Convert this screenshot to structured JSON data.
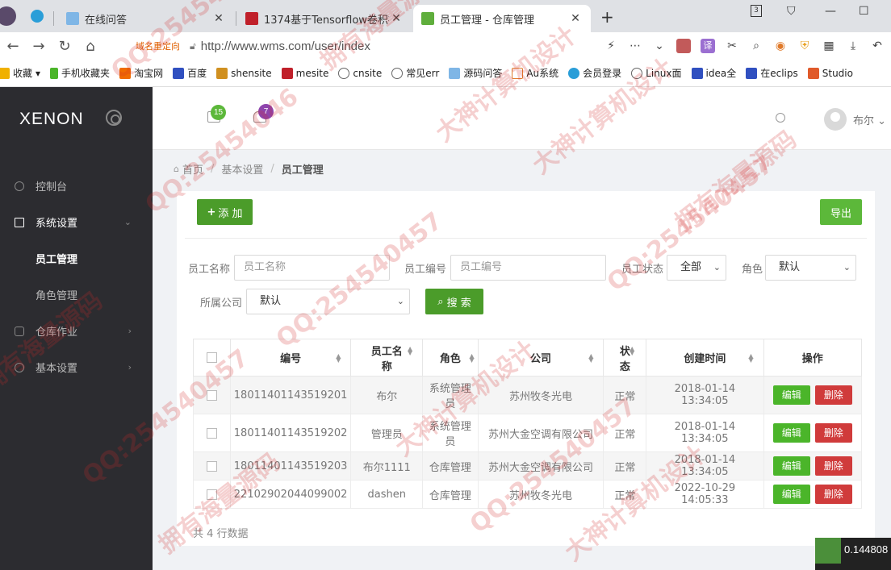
{
  "browser": {
    "tabs": [
      {
        "title": "在线问答",
        "active": false
      },
      {
        "title": "1374基于Tensorflow卷积神经",
        "active": false
      },
      {
        "title": "员工管理 - 仓库管理",
        "active": true
      }
    ],
    "domain_redirect": "域名重定向",
    "url": "http://www.wms.com/user/index",
    "bookmarks": [
      "收藏",
      "手机收藏夹",
      "淘宝网",
      "百度",
      "shensite",
      "mesite",
      "cnsite",
      "常见err",
      "源码问答",
      "Au系统",
      "会员登录",
      "Linux面",
      "idea全",
      "在eclips",
      "Studio"
    ]
  },
  "app": {
    "logo": "XENON",
    "header": {
      "mail_badge": "15",
      "bell_badge": "7",
      "user_name": "布尔"
    },
    "menu": {
      "dashboard": "控制台",
      "system": "系统设置",
      "employee": "员工管理",
      "role": "角色管理",
      "warehouse": "仓库作业",
      "basic": "基本设置"
    },
    "breadcrumb": {
      "home": "首页",
      "level1": "基本设置",
      "current": "员工管理"
    },
    "toolbar": {
      "add_label": "添 加",
      "export_label": "导出"
    },
    "filters": {
      "name_label": "员工名称",
      "name_placeholder": "员工名称",
      "code_label": "员工编号",
      "code_placeholder": "员工编号",
      "status_label": "员工状态",
      "status_value": "全部",
      "role_label": "角色",
      "role_value": "默认",
      "company_label": "所属公司",
      "company_value": "默认",
      "search_label": "搜 索"
    },
    "table": {
      "headers": {
        "code": "编号",
        "name": "员工名称",
        "role": "角色",
        "company": "公司",
        "status": "状态",
        "created": "创建时间",
        "action": "操作"
      },
      "edit_label": "编辑",
      "delete_label": "删除",
      "rows": [
        {
          "code": "18011401143519201",
          "name": "布尔",
          "role": "系统管理员",
          "company": "苏州牧冬光电",
          "status": "正常",
          "created": "2018-01-14 13:34:05"
        },
        {
          "code": "18011401143519202",
          "name": "管理员",
          "role": "系统管理员",
          "company": "苏州大金空调有限公司",
          "status": "正常",
          "created": "2018-01-14 13:34:05"
        },
        {
          "code": "18011401143519203",
          "name": "布尔1111",
          "role": "仓库管理",
          "company": "苏州大金空调有限公司",
          "status": "正常",
          "created": "2018-01-14 13:34:05"
        },
        {
          "code": "22102902044099002",
          "name": "dashen",
          "role": "仓库管理",
          "company": "苏州牧冬光电",
          "status": "正常",
          "created": "2022-10-29 14:05:33"
        }
      ],
      "total_text": "共 4 行数据"
    }
  },
  "corner_widget": {
    "value": "0.144808"
  },
  "watermarks": [
    "QQ:2545404",
    "拥有海量源码",
    "大神计算机设计",
    "QQ:25454046",
    "大神计算机设计",
    "拥有海量源码",
    "QQ:254540457",
    "QQ:254540457",
    "拥有海量源码",
    "大神计算机设计",
    "QQ:254540457",
    "QQ:254540457",
    "拥有海量源码",
    "大神计算机设计"
  ],
  "colors": {
    "primary_green": "#4b9c2a",
    "danger_red": "#d03b3b",
    "sidebar_bg": "#2c2c30"
  }
}
